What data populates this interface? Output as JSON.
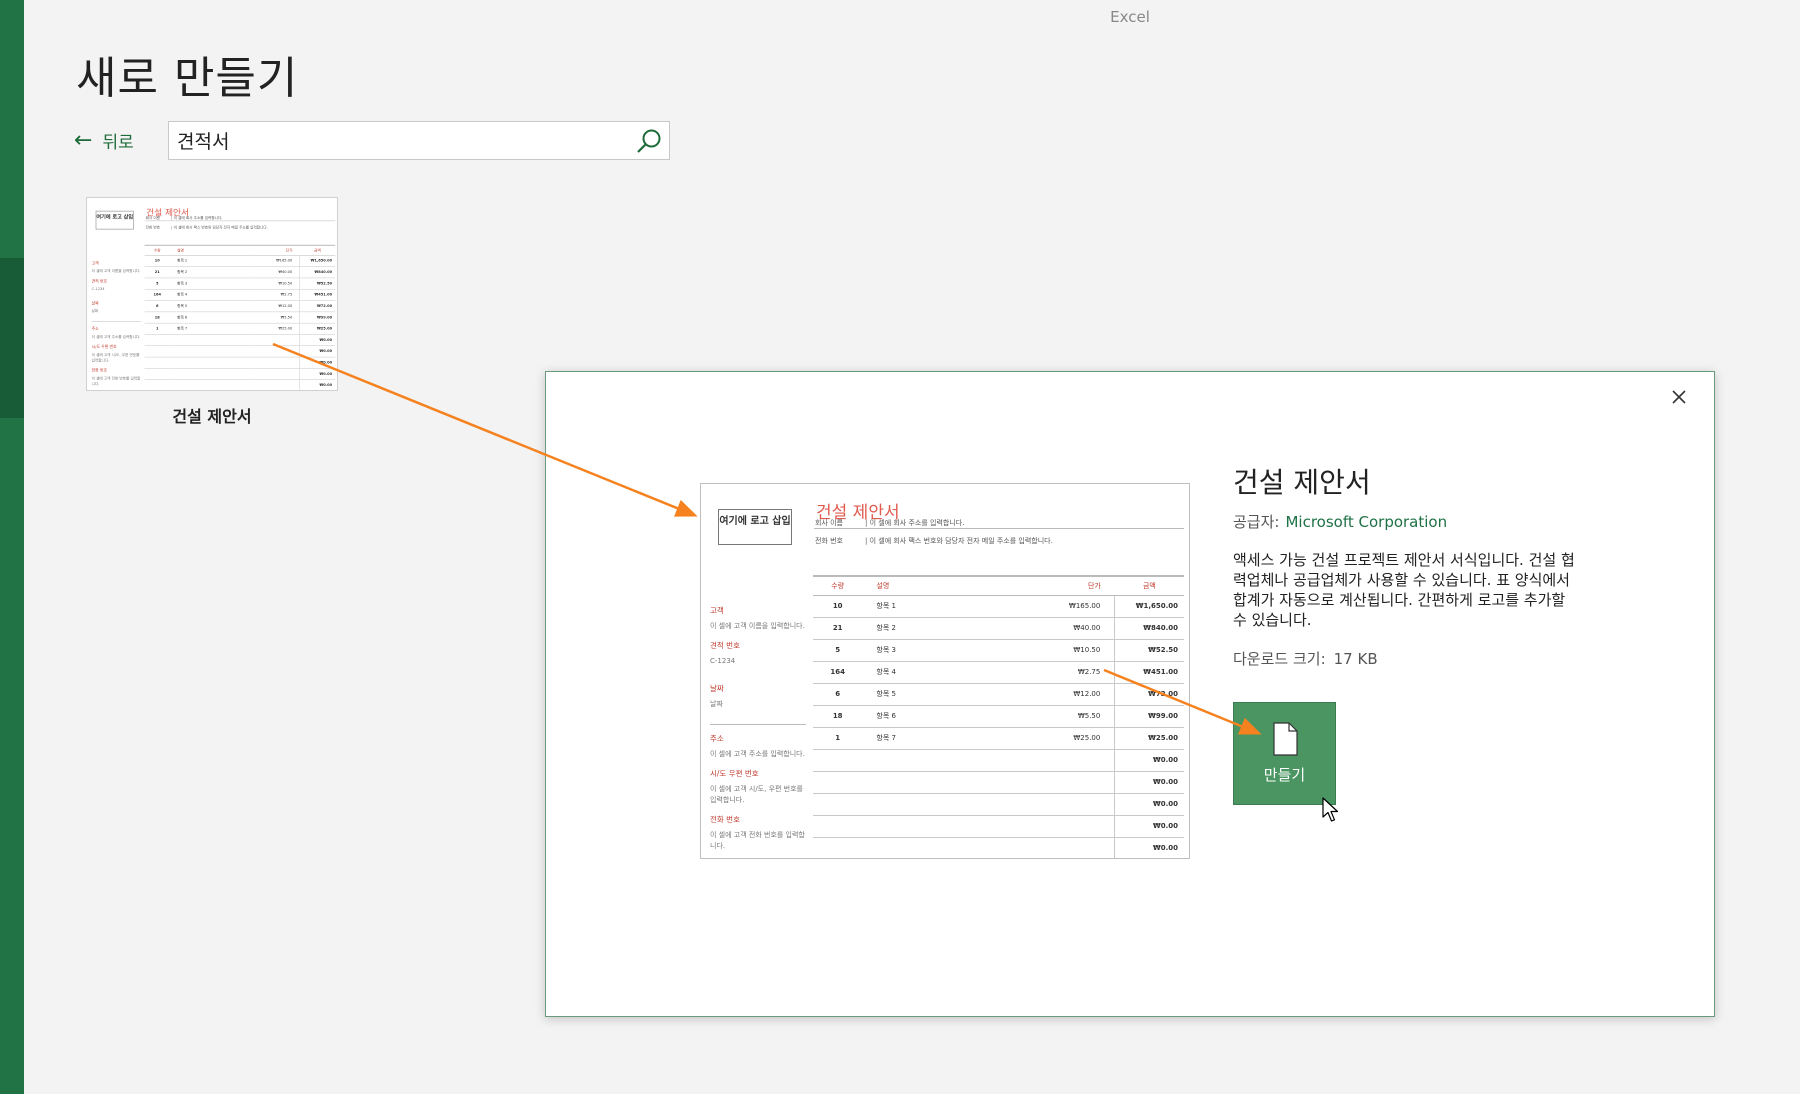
{
  "app": {
    "title": "Excel"
  },
  "page": {
    "title": "새로 만들기",
    "back_label": "뒤로"
  },
  "search": {
    "value": "견적서"
  },
  "template_tile": {
    "label": "건설 제안서"
  },
  "dialog": {
    "name": "건설 제안서",
    "provider_label": "공급자:",
    "provider": "Microsoft Corporation",
    "description": "액세스 가능 건설 프로젝트 제안서 서식입니다. 건설 협력업체나 공급업체가 사용할 수 있습니다. 표 양식에서 합계가 자동으로 계산됩니다. 간편하게 로고를 추가할 수 있습니다.",
    "download_label": "다운로드 크기:",
    "download_size": "17 KB",
    "create_label": "만들기"
  },
  "preview": {
    "logo_text": "여기에 로고 삽입",
    "title": "건설 제안서",
    "company_key": "회사 이름",
    "company_val": "| 이 셀에 회사 주소를 입력합니다.",
    "phone_key": "전화 번호",
    "phone_val": "| 이 셀에 회사 팩스 번호와 담당자 전자 메일 주소를 입력합니다.",
    "side": {
      "customer_label": "고객",
      "customer_val": "이 셀에 고객 이름을 입력합니다.",
      "quote_label": "견적 번호",
      "quote_val": "C-1234",
      "date_label": "날짜",
      "date_val": "날짜",
      "address_label": "주소",
      "address_val": "이 셀에 고객 주소를 입력합니다.",
      "city_label": "시/도 우편 번호",
      "city_val": "이 셀에 고객 시/도, 우편 번호를 입력합니다.",
      "phone_label": "전화 번호",
      "phone_val": "이 셀에 고객 전화 번호를 입력합니다."
    },
    "table": {
      "headers": [
        "수량",
        "설명",
        "단가",
        "금액"
      ],
      "rows": [
        [
          "10",
          "항목 1",
          "₩165.00",
          "₩1,650.00"
        ],
        [
          "21",
          "항목 2",
          "₩40.00",
          "₩840.00"
        ],
        [
          "5",
          "항목 3",
          "₩10.50",
          "₩52.50"
        ],
        [
          "164",
          "항목 4",
          "₩2.75",
          "₩451.00"
        ],
        [
          "6",
          "항목 5",
          "₩12.00",
          "₩72.00"
        ],
        [
          "18",
          "항목 6",
          "₩5.50",
          "₩99.00"
        ],
        [
          "1",
          "항목 7",
          "₩25.00",
          "₩25.00"
        ],
        [
          "",
          "",
          "",
          "₩0.00"
        ],
        [
          "",
          "",
          "",
          "₩0.00"
        ],
        [
          "",
          "",
          "",
          "₩0.00"
        ],
        [
          "",
          "",
          "",
          "₩0.00"
        ],
        [
          "",
          "",
          "",
          "₩0.00"
        ]
      ]
    }
  },
  "colors": {
    "accent": "#217346",
    "arrow": "#f5821f",
    "title_red": "#e05a4e"
  }
}
